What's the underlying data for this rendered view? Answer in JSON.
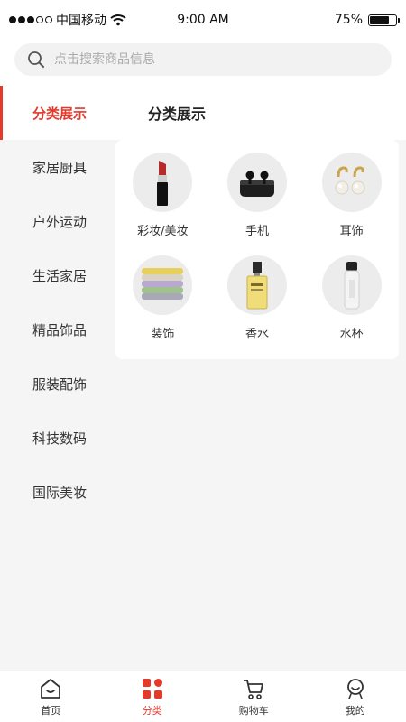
{
  "status_bar": {
    "carrier": "中国移动",
    "time": "9:00 AM",
    "battery": "75%",
    "battery_level": 0.75
  },
  "search": {
    "placeholder": "点击搜索商品信息",
    "icon": "search-icon"
  },
  "sidebar": {
    "items": [
      {
        "label": "分类展示",
        "active": true
      },
      {
        "label": "家居厨具",
        "active": false
      },
      {
        "label": "户外运动",
        "active": false
      },
      {
        "label": "生活家居",
        "active": false
      },
      {
        "label": "精品饰品",
        "active": false
      },
      {
        "label": "服装配饰",
        "active": false
      },
      {
        "label": "科技数码",
        "active": false
      },
      {
        "label": "国际美妆",
        "active": false
      }
    ]
  },
  "content": {
    "title": "分类展示",
    "categories": [
      {
        "label": "彩妆/美妆",
        "icon": "lipstick-icon"
      },
      {
        "label": "手机",
        "icon": "earbuds-icon"
      },
      {
        "label": "耳饰",
        "icon": "pearl-earrings-icon"
      },
      {
        "label": "装饰",
        "icon": "folded-towels-icon"
      },
      {
        "label": "香水",
        "icon": "perfume-bottle-icon"
      },
      {
        "label": "水杯",
        "icon": "water-bottle-icon"
      }
    ]
  },
  "tabbar": {
    "tabs": [
      {
        "label": "首页",
        "icon": "home-icon",
        "active": false
      },
      {
        "label": "分类",
        "icon": "category-grid-icon",
        "active": true
      },
      {
        "label": "购物车",
        "icon": "cart-icon",
        "active": false
      },
      {
        "label": "我的",
        "icon": "profile-icon",
        "active": false
      }
    ]
  },
  "colors": {
    "accent": "#e4392b",
    "background": "#f5f5f5",
    "card": "#ffffff"
  }
}
